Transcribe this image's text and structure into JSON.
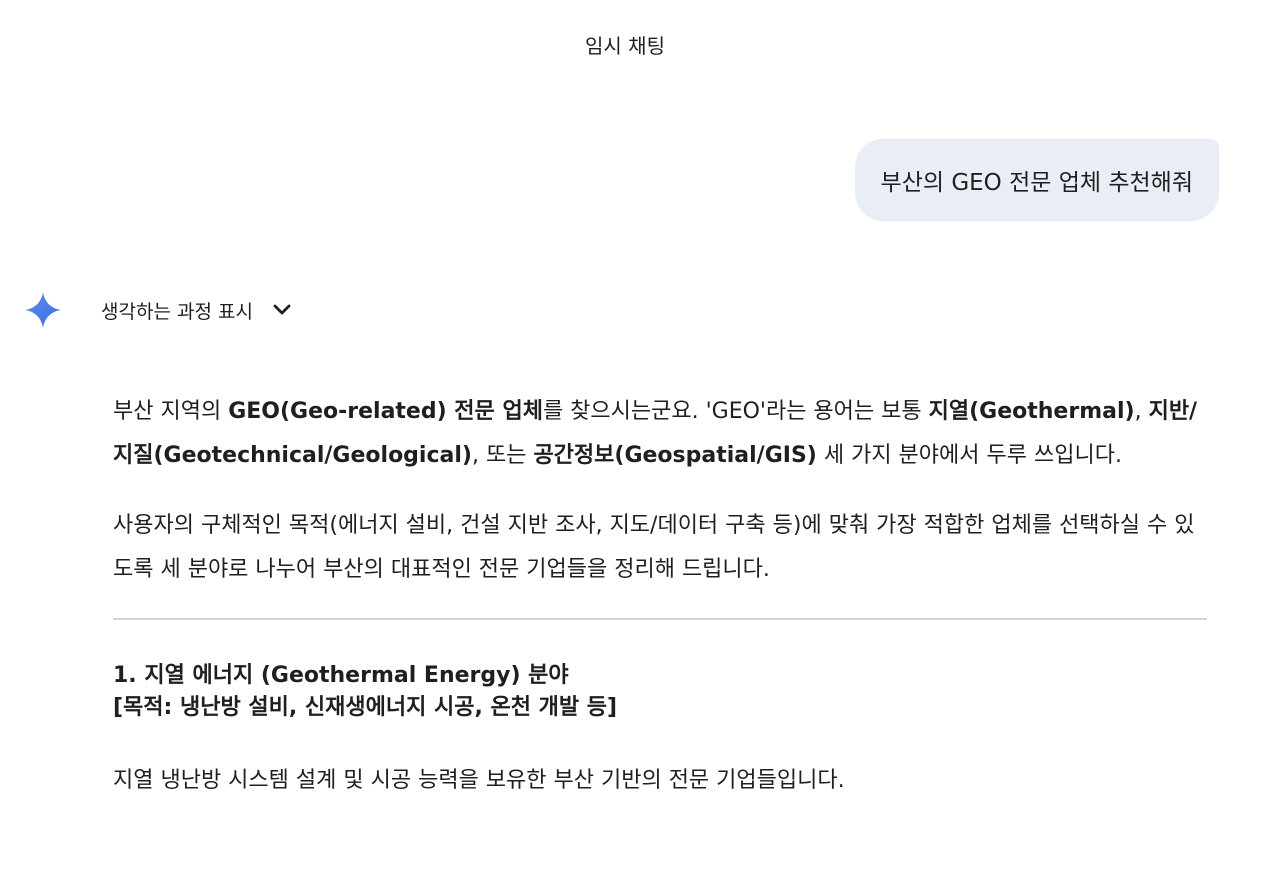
{
  "header": {
    "title": "임시 채팅"
  },
  "user_message": {
    "text": "부산의 GEO 전문 업체 추천해줘"
  },
  "thinking": {
    "label": "생각하는 과정 표시",
    "icon": "chevron-down-icon"
  },
  "answer": {
    "p1": {
      "t1": "부산 지역의 ",
      "b1": "GEO(Geo-related) 전문 업체",
      "t2": "를 찾으시는군요. 'GEO'라는 용어는 보통 ",
      "b2": "지열(Geothermal)",
      "t3": ", ",
      "b3": "지반/지질(Geotechnical/Geological)",
      "t4": ", 또는 ",
      "b4": "공간정보(Geospatial/GIS)",
      "t5": " 세 가지 분야에서 두루 쓰입니다."
    },
    "p2": "사용자의 구체적인 목적(에너지 설비, 건설 지반 조사, 지도/데이터 구축 등)에 맞춰 가장 적합한 업체를 선택하실 수 있도록 세 분야로 나누어 부산의 대표적인 전문 기업들을 정리해 드립니다.",
    "section1": {
      "heading": "1. 지열 에너지 (Geothermal Energy) 분야",
      "purpose": "[목적: 냉난방 설비, 신재생에너지 시공, 온천 개발 등]",
      "desc": "지열 냉난방 시스템 설계 및 시공 능력을 보유한 부산 기반의 전문 기업들입니다."
    }
  },
  "colors": {
    "user_bubble_bg": "#e9eef6",
    "text": "#1f1f1f",
    "divider": "#d3d3d3",
    "gemini_blue": "#4285f4"
  }
}
